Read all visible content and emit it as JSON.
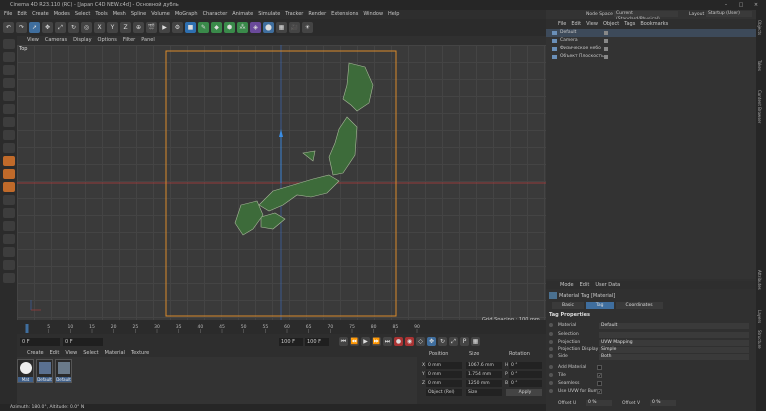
{
  "app": {
    "title": "Cinema 4D R23.110 (RC) - [Japan C4D NEW.c4d] - Основной дубль"
  },
  "menubar": [
    "File",
    "Edit",
    "Create",
    "Modes",
    "Select",
    "Tools",
    "Mesh",
    "Spline",
    "Volume",
    "MoGraph",
    "Character",
    "Animate",
    "Simulate",
    "Tracker",
    "Render",
    "Extensions",
    "Window",
    "Help"
  ],
  "toolbar": {
    "x": "X",
    "y": "Y",
    "z": "Z"
  },
  "viewport": {
    "menu": [
      "View",
      "Cameras",
      "Display",
      "Options",
      "Filter",
      "Panel"
    ],
    "label": "Top",
    "grid_spacing": "Grid Spacing : 100 mm"
  },
  "timeline": {
    "ticks": [
      "0",
      "5",
      "10",
      "15",
      "20",
      "25",
      "30",
      "35",
      "40",
      "45",
      "50",
      "55",
      "60",
      "65",
      "70",
      "75",
      "80",
      "85",
      "90"
    ],
    "current": "0 F",
    "start": "0 F",
    "end": "100 F",
    "end2": "100 F"
  },
  "matmgr": {
    "menu": [
      "Create",
      "Edit",
      "View",
      "Select",
      "Material",
      "Texture"
    ],
    "materials": [
      "Mat",
      "Default",
      "Default"
    ]
  },
  "coords": {
    "headers": [
      "Position",
      "Size",
      "Rotation"
    ],
    "rows": [
      {
        "axis": "X",
        "pos": "0 mm",
        "size": "1067.6 mm",
        "rotlab": "H",
        "rot": "0 °"
      },
      {
        "axis": "Y",
        "pos": "0 mm",
        "size": "1.754 mm",
        "rotlab": "P",
        "rot": "0 °"
      },
      {
        "axis": "Z",
        "pos": "0 mm",
        "size": "1250 mm",
        "rotlab": "B",
        "rot": "0 °"
      }
    ],
    "mode1": "Object (Rel)",
    "mode2": "Size",
    "apply": "Apply"
  },
  "status": "Azimuth: 180.0°, Altitude: 0.0° N",
  "objmgr": {
    "menu": [
      "File",
      "Edit",
      "View",
      "Object",
      "Tags",
      "Bookmarks"
    ],
    "node_space_label": "Node Space",
    "node_space": "Current (Standard/Physical)",
    "layout_label": "Layout",
    "layout": "Startup (User)",
    "objects": [
      "Default",
      "Camera",
      "Физическое небо",
      "Объект Плоскость"
    ]
  },
  "attr": {
    "menu": [
      "Mode",
      "Edit",
      "User Data"
    ],
    "title": "Material Tag [Material]",
    "tabs": [
      "Basic",
      "Tag",
      "Coordinates"
    ],
    "section": "Tag Properties",
    "rows": [
      {
        "label": "Material",
        "value": "Default"
      },
      {
        "label": "Selection",
        "value": ""
      },
      {
        "label": "Projection",
        "value": "UVW Mapping"
      },
      {
        "label": "Projection Display",
        "value": "Simple"
      },
      {
        "label": "Side",
        "value": "Both"
      }
    ],
    "checks": [
      "Add Material",
      "Tile",
      "Seamless",
      "Use UVW for Bump"
    ],
    "offset_u_label": "Offset U",
    "offset_u": "0 %",
    "offset_v_label": "Offset V",
    "offset_v": "0 %"
  },
  "right_tabs": [
    "Objects",
    "Takes",
    "Content Browser",
    "Attributes",
    "Layers",
    "Structure"
  ],
  "colors": {
    "accent": "#3f6e9e",
    "frame": "#d98a2b",
    "axis_red": "#b33a3a"
  }
}
